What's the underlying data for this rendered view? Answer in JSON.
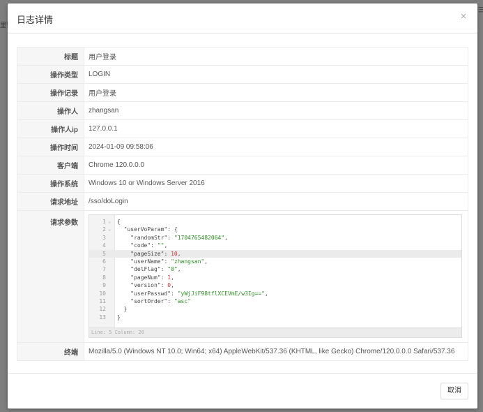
{
  "background": {
    "left_text": "里管",
    "right_text": "三"
  },
  "modal": {
    "title": "日志详情",
    "close_icon": "×",
    "cancel_label": "取消"
  },
  "rows": [
    {
      "label": "标题",
      "value": "用户登录"
    },
    {
      "label": "操作类型",
      "value": "LOGIN"
    },
    {
      "label": "操作记录",
      "value": "用户登录"
    },
    {
      "label": "操作人",
      "value": "zhangsan"
    },
    {
      "label": "操作人ip",
      "value": "127.0.0.1"
    },
    {
      "label": "操作时间",
      "value": "2024-01-09 09:58:06"
    },
    {
      "label": "客户端",
      "value": "Chrome 120.0.0.0"
    },
    {
      "label": "操作系统",
      "value": "Windows 10 or Windows Server 2016"
    },
    {
      "label": "请求地址",
      "value": "/sso/doLogin"
    }
  ],
  "params": {
    "label": "请求参数",
    "lines": [
      {
        "n": "1",
        "fold": "⌄",
        "parts": [
          [
            "punct",
            "{"
          ]
        ]
      },
      {
        "n": "2",
        "fold": "⌄",
        "parts": [
          [
            "k1",
            "  \"userVoParam\""
          ],
          [
            "punct",
            ": {"
          ]
        ]
      },
      {
        "n": "3",
        "parts": [
          [
            "k1",
            "    \"randomStr\""
          ],
          [
            "punct",
            ": "
          ],
          [
            "str",
            "\"1704765482064\""
          ],
          [
            "punct",
            ","
          ]
        ]
      },
      {
        "n": "4",
        "parts": [
          [
            "k1",
            "    \"code\""
          ],
          [
            "punct",
            ": "
          ],
          [
            "str",
            "\"\""
          ],
          [
            "punct",
            ","
          ]
        ]
      },
      {
        "n": "5",
        "active": true,
        "parts": [
          [
            "k1",
            "    \"pageSize\""
          ],
          [
            "punct",
            ": "
          ],
          [
            "num",
            "10"
          ],
          [
            "punct",
            ","
          ]
        ]
      },
      {
        "n": "6",
        "parts": [
          [
            "k1",
            "    \"userName\""
          ],
          [
            "punct",
            ": "
          ],
          [
            "str",
            "\"zhangsan\""
          ],
          [
            "punct",
            ","
          ]
        ]
      },
      {
        "n": "7",
        "parts": [
          [
            "k1",
            "    \"delFlag\""
          ],
          [
            "punct",
            ": "
          ],
          [
            "str",
            "\"0\""
          ],
          [
            "punct",
            ","
          ]
        ]
      },
      {
        "n": "8",
        "parts": [
          [
            "k1",
            "    \"pageNum\""
          ],
          [
            "punct",
            ": "
          ],
          [
            "num",
            "1"
          ],
          [
            "punct",
            ","
          ]
        ]
      },
      {
        "n": "9",
        "parts": [
          [
            "k1",
            "    \"version\""
          ],
          [
            "punct",
            ": "
          ],
          [
            "num",
            "0"
          ],
          [
            "punct",
            ","
          ]
        ]
      },
      {
        "n": "10",
        "parts": [
          [
            "k1",
            "    \"userPasswd\""
          ],
          [
            "punct",
            ": "
          ],
          [
            "str",
            "\"yWjJiF98tflXCEVmE/w3Ig==\""
          ],
          [
            "punct",
            ","
          ]
        ]
      },
      {
        "n": "11",
        "parts": [
          [
            "k1",
            "    \"sortOrder\""
          ],
          [
            "punct",
            ": "
          ],
          [
            "str",
            "\"asc\""
          ]
        ]
      },
      {
        "n": "12",
        "parts": [
          [
            "punct",
            "  }"
          ]
        ]
      },
      {
        "n": "13",
        "parts": [
          [
            "punct",
            "}"
          ]
        ]
      }
    ],
    "status": "Line: 5  Column: 20"
  },
  "terminal": {
    "label": "终端",
    "value": "Mozilla/5.0 (Windows NT 10.0; Win64; x64) AppleWebKit/537.36 (KHTML, like Gecko) Chrome/120.0.0.0 Safari/537.36"
  }
}
